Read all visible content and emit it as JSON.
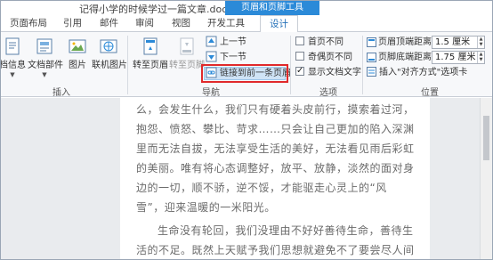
{
  "window": {
    "title": "记得小学的时候学过一篇文章.docx - Word"
  },
  "context_tab_header": "页眉和页脚工具",
  "tabs": [
    "页面布局",
    "引用",
    "邮件",
    "审阅",
    "视图",
    "开发工具",
    "设计"
  ],
  "active_tab": "设计",
  "ribbon": {
    "insert_group": {
      "label": "插入",
      "buttons": [
        "档信息",
        "文档部件",
        "图片",
        "联机图片"
      ]
    },
    "nav_group": {
      "label": "导航",
      "goto_header": "转至页眉",
      "goto_footer": "转至页脚",
      "previous": "上一节",
      "next": "下一节",
      "link_previous": "链接到前一条页眉"
    },
    "options_group": {
      "label": "选项",
      "checkboxes": [
        {
          "label": "首页不同",
          "checked": false
        },
        {
          "label": "奇偶页不同",
          "checked": false
        },
        {
          "label": "显示文档文字",
          "checked": true
        }
      ]
    },
    "position_group": {
      "label": "位置",
      "header_distance_label": "页眉顶端距离:",
      "header_distance_value": "1.5 厘米",
      "footer_distance_label": "页脚底端距离:",
      "footer_distance_value": "1.75 厘米",
      "insert_alignment_tab": "插入\"对齐方式\"选项卡"
    }
  },
  "document": {
    "lines": [
      "么，会发生什么，我们只有硬着头皮前行，摸索着过河，",
      "抱怨、愤怒、攀比、苛求……只会让自己更加的陷入深渊",
      "里而无法自拔，无法享受生活的美好，无法看见雨后彩虹",
      "的美丽。唯有将心态调整好，放平、放静，淡然的面对身",
      "边的一切，顺不骄，逆不馁，才能驱走心灵上的“风",
      "雪”，迎来温暖的一米阳光。",
      "生命没有轮回，我们没理由不好好善待生命，善待生",
      "活的不足。既然上天赋予我们思想就避免不了要尝尽人间"
    ]
  },
  "colors": {
    "accent": "#2b8ad8",
    "highlight_box": "#e0292b",
    "body_text": "#6b6b6b"
  }
}
